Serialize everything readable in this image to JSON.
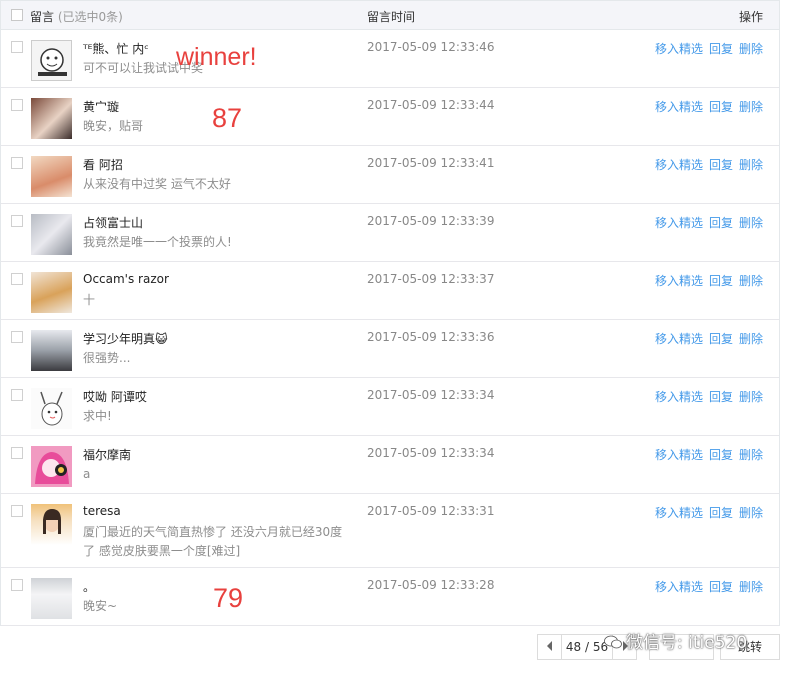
{
  "header": {
    "col_comment": "留言",
    "col_selected": "(已选中0条)",
    "col_time": "留言时间",
    "col_ops": "操作"
  },
  "ops_labels": [
    "移入精选",
    "回复",
    "删除"
  ],
  "comments": [
    {
      "nickname": "ᵀᴱ熊、忙 内ᶜ",
      "message": "可不可以让我试试中奖",
      "time": "2017-05-09 12:33:46"
    },
    {
      "nickname": "黄宀璇",
      "message": "晚安，贴哥",
      "time": "2017-05-09 12:33:44"
    },
    {
      "nickname": "看 阿招",
      "message": "从来没有中过奖 运气不太好",
      "time": "2017-05-09 12:33:41"
    },
    {
      "nickname": "占领富士山",
      "message": "我竟然是唯一一个投票的人!",
      "time": "2017-05-09 12:33:39"
    },
    {
      "nickname": "Occam's razor",
      "message": "十",
      "time": "2017-05-09 12:33:37"
    },
    {
      "nickname": "学习少年明真😺",
      "message": "很强势...",
      "time": "2017-05-09 12:33:36"
    },
    {
      "nickname": "哎呦 阿谭哎",
      "message": "求中!",
      "time": "2017-05-09 12:33:34"
    },
    {
      "nickname": "福尔摩南",
      "message": "a",
      "time": "2017-05-09 12:33:34"
    },
    {
      "nickname": "teresa",
      "message": "厦门最近的天气简直热惨了 还没六月就已经30度了 感觉皮肤要黑一个度[难过]",
      "time": "2017-05-09 12:33:31"
    },
    {
      "nickname": "。",
      "message": "晚安~",
      "time": "2017-05-09 12:33:28"
    }
  ],
  "annotations": {
    "winner": "winner!",
    "num1": "87",
    "num2": "79"
  },
  "pagination": {
    "page_display": "48 / 56",
    "jump_label": "跳转"
  },
  "watermark": "微信号: itie520",
  "colors": {
    "link": "#459ae9",
    "annotation": "#e8413e",
    "header_bg": "#f4f5f9"
  }
}
